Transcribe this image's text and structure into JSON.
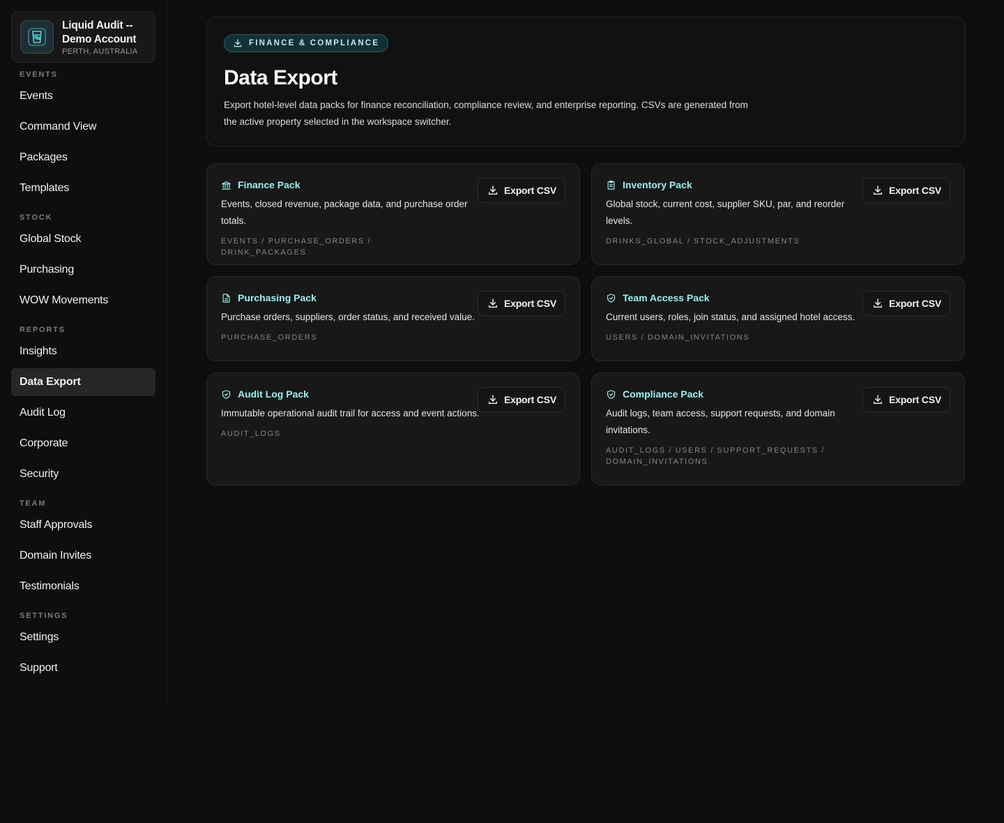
{
  "account": {
    "name": "Liquid Audit -- Demo Account",
    "location": "PERTH, AUSTRALIA",
    "logo_icon": "glass-icon"
  },
  "sidebar": {
    "sections": [
      {
        "label": "EVENTS",
        "items": [
          "Events",
          "Command View",
          "Packages",
          "Templates"
        ]
      },
      {
        "label": "STOCK",
        "items": [
          "Global Stock",
          "Purchasing",
          "WOW Movements"
        ]
      },
      {
        "label": "REPORTS",
        "items": [
          "Insights",
          "Data Export",
          "Audit Log",
          "Corporate",
          "Security"
        ]
      },
      {
        "label": "TEAM",
        "items": [
          "Staff Approvals",
          "Domain Invites",
          "Testimonials"
        ]
      },
      {
        "label": "SETTINGS",
        "items": [
          "Settings",
          "Support"
        ]
      }
    ],
    "active_item": "Data Export"
  },
  "header": {
    "badge": "FINANCE & COMPLIANCE",
    "title": "Data Export",
    "description": "Export hotel-level data packs for finance reconciliation, compliance review, and enterprise reporting. CSVs are generated from the active property selected in the workspace switcher."
  },
  "export_label": "Export CSV",
  "packs": [
    {
      "title": "Finance Pack",
      "icon": "bank-icon",
      "description": "Events, closed revenue, package data, and purchase order totals.",
      "tables": "EVENTS / PURCHASE_ORDERS / DRINK_PACKAGES"
    },
    {
      "title": "Inventory Pack",
      "icon": "clipboard-icon",
      "description": "Global stock, current cost, supplier SKU, par, and reorder levels.",
      "tables": "DRINKS_GLOBAL / STOCK_ADJUSTMENTS"
    },
    {
      "title": "Purchasing Pack",
      "icon": "document-icon",
      "description": "Purchase orders, suppliers, order status, and received value.",
      "tables": "PURCHASE_ORDERS"
    },
    {
      "title": "Team Access Pack",
      "icon": "shield-check-icon",
      "description": "Current users, roles, join status, and assigned hotel access.",
      "tables": "USERS / DOMAIN_INVITATIONS"
    },
    {
      "title": "Audit Log Pack",
      "icon": "shield-check-icon",
      "description": "Immutable operational audit trail for access and event actions.",
      "tables": "AUDIT_LOGS"
    },
    {
      "title": "Compliance Pack",
      "icon": "shield-check-icon",
      "description": "Audit logs, team access, support requests, and domain invitations.",
      "tables": "AUDIT_LOGS / USERS / SUPPORT_REQUESTS / DOMAIN_INVITATIONS"
    }
  ],
  "colors": {
    "accent": "#9deef2",
    "background": "#0e0e0e",
    "card": "#181818",
    "active_nav": "#262626"
  }
}
